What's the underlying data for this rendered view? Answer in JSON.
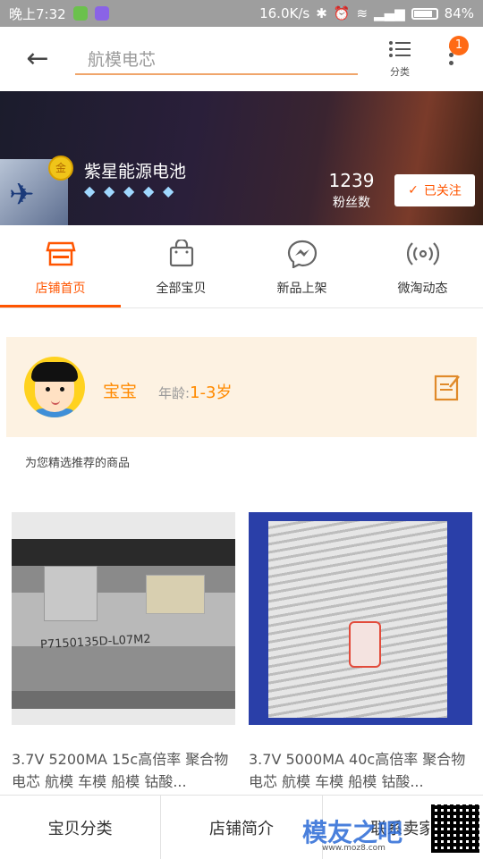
{
  "status_bar": {
    "time": "晚上7:32",
    "speed": "16.0K/s",
    "battery": "84%"
  },
  "topbar": {
    "search_text": "航模电芯",
    "category_label": "分类",
    "badge_count": "1"
  },
  "shop": {
    "name": "紫星能源电池",
    "fans_count": "1239",
    "fans_label": "粉丝数",
    "follow_label": "已关注",
    "gold_badge": "金",
    "diamonds": [
      "◆",
      "◆",
      "◆",
      "◆",
      "◆"
    ]
  },
  "tabs": [
    {
      "label": "店铺首页",
      "active": true,
      "icon": "store-icon"
    },
    {
      "label": "全部宝贝",
      "active": false,
      "icon": "bag-icon"
    },
    {
      "label": "新品上架",
      "active": false,
      "icon": "messenger-icon"
    },
    {
      "label": "微淘动态",
      "active": false,
      "icon": "broadcast-icon"
    }
  ],
  "profile": {
    "name": "宝宝",
    "age_label": "年龄:",
    "age_value": "1-3岁"
  },
  "recommend_label": "为您精选推荐的商品",
  "products": [
    {
      "title": "3.7V 5200MA 15c高倍率 聚合物 电芯 航模 车模 船模 钴酸...",
      "image_label": "P7150135D-L07M2"
    },
    {
      "title": "3.7V 5000MA 40c高倍率 聚合物 电芯 航模 车模 船模 钴酸..."
    }
  ],
  "bottom_nav": [
    "宝贝分类",
    "店铺简介",
    "联系卖家"
  ],
  "watermark": {
    "text": "模友之吧",
    "url": "www.moz8.com"
  },
  "colors": {
    "accent": "#ff5500",
    "profile_bg": "#fdf2e2"
  }
}
